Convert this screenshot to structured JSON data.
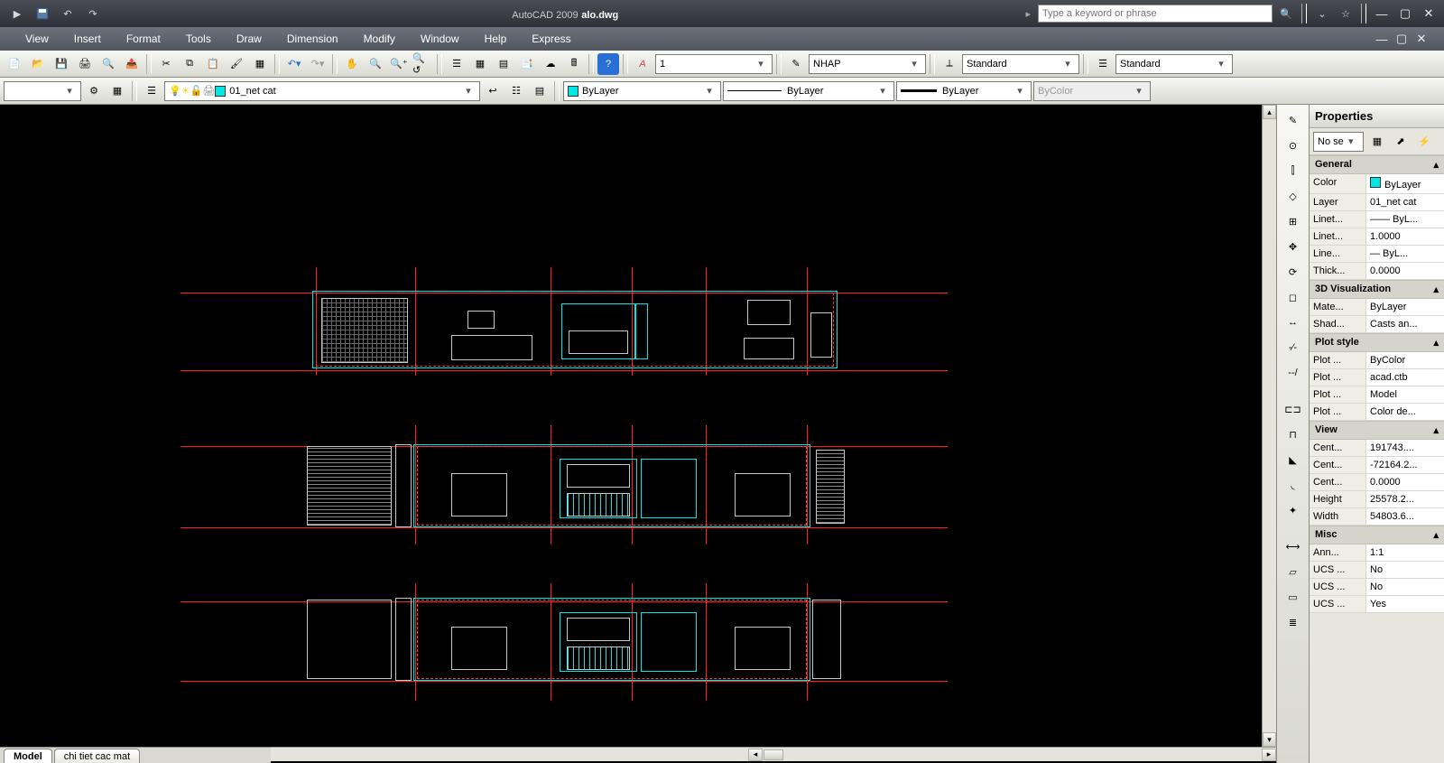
{
  "title": {
    "app": "AutoCAD 2009",
    "file": "alo.dwg"
  },
  "search": {
    "placeholder": "Type a keyword or phrase"
  },
  "menus": [
    "View",
    "Insert",
    "Format",
    "Tools",
    "Draw",
    "Dimension",
    "Modify",
    "Window",
    "Help",
    "Express"
  ],
  "toolbar1": {
    "annotation_scale": "1",
    "textstyle": "NHAP",
    "dimstyle": "Standard",
    "tablestyle": "Standard"
  },
  "toolbar2": {
    "layer": "01_net cat",
    "color": "ByLayer",
    "linetype": "ByLayer",
    "lineweight": "ByLayer",
    "plotstyle": "ByColor"
  },
  "layout_tabs": {
    "active": "Model",
    "other": "chi tiet cac mat"
  },
  "properties": {
    "title": "Properties",
    "selection": "No se",
    "groups": [
      {
        "name": "General",
        "rows": [
          {
            "k": "Color",
            "v": "ByLayer",
            "swatch": true
          },
          {
            "k": "Layer",
            "v": "01_net cat"
          },
          {
            "k": "Linet...",
            "v": "—— ByL..."
          },
          {
            "k": "Linet...",
            "v": "1.0000"
          },
          {
            "k": "Line...",
            "v": "— ByL..."
          },
          {
            "k": "Thick...",
            "v": "0.0000"
          }
        ]
      },
      {
        "name": "3D Visualization",
        "rows": [
          {
            "k": "Mate...",
            "v": "ByLayer"
          },
          {
            "k": "Shad...",
            "v": "Casts an..."
          }
        ]
      },
      {
        "name": "Plot style",
        "rows": [
          {
            "k": "Plot ...",
            "v": "ByColor"
          },
          {
            "k": "Plot ...",
            "v": "acad.ctb"
          },
          {
            "k": "Plot ...",
            "v": "Model"
          },
          {
            "k": "Plot ...",
            "v": "Color de..."
          }
        ]
      },
      {
        "name": "View",
        "rows": [
          {
            "k": "Cent...",
            "v": "191743...."
          },
          {
            "k": "Cent...",
            "v": "-72164.2..."
          },
          {
            "k": "Cent...",
            "v": "0.0000"
          },
          {
            "k": "Height",
            "v": "25578.2..."
          },
          {
            "k": "Width",
            "v": "54803.6..."
          }
        ]
      },
      {
        "name": "Misc",
        "rows": [
          {
            "k": "Ann...",
            "v": "1:1"
          },
          {
            "k": "UCS ...",
            "v": "No"
          },
          {
            "k": "UCS ...",
            "v": "No"
          },
          {
            "k": "UCS ...",
            "v": "Yes"
          }
        ]
      }
    ]
  }
}
